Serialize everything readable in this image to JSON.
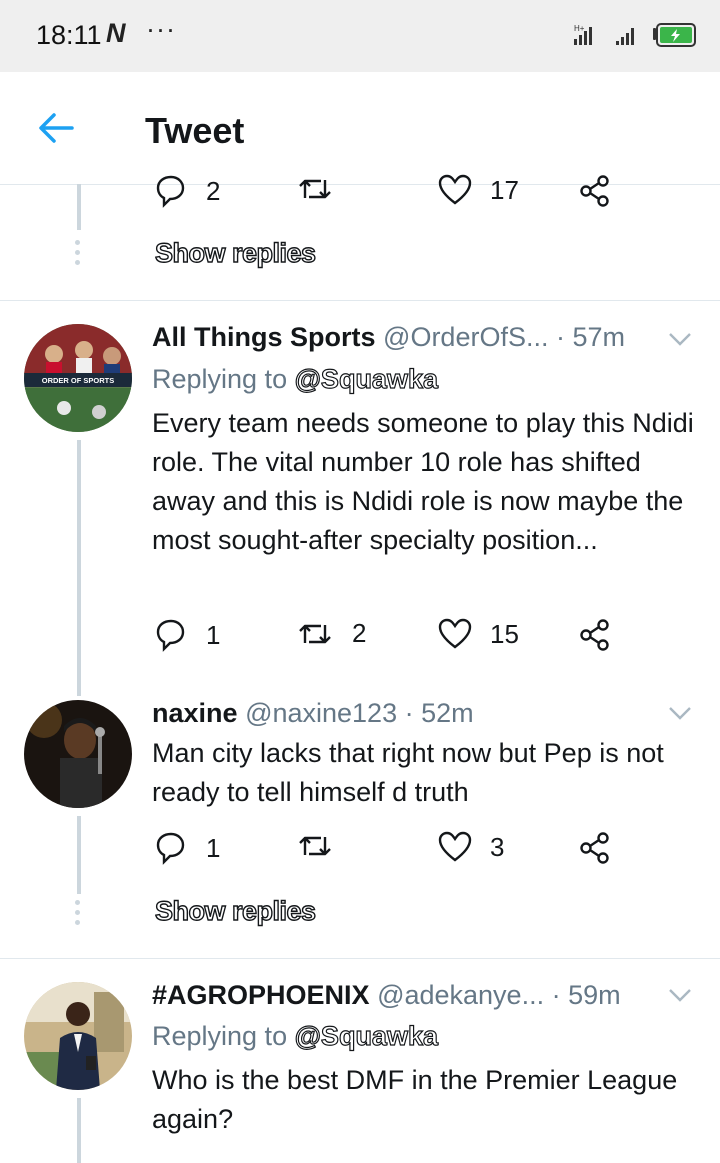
{
  "status_bar": {
    "time": "18:11",
    "carrier_glyph": "N",
    "more": "···",
    "battery_color": "#3bb54a"
  },
  "app_bar": {
    "back_icon": "arrow-left-icon",
    "title": "Tweet",
    "accent": "#1da1f2"
  },
  "top_partial": {
    "reply_count": "2",
    "retweet_count": "",
    "like_count": "17",
    "show_replies": "Show replies"
  },
  "tweets": [
    {
      "name": "All Things Sports",
      "handle": "@OrderOfS...",
      "time": "· 57m",
      "replying_prefix": "Replying to",
      "replying_to": "@Squawka",
      "text": "Every team needs someone to play this Ndidi role. The vital number 10 role has shifted away and this is Ndidi role is now maybe the most sought-after specialty position...",
      "reply_count": "1",
      "retweet_count": "2",
      "like_count": "15",
      "avatar_label": "ORDER OF SPORTS"
    },
    {
      "name": "naxine",
      "handle": "@naxine123",
      "time": "· 52m",
      "text": "Man city lacks that right now but Pep is not ready to tell himself d truth",
      "reply_count": "1",
      "retweet_count": "",
      "like_count": "3",
      "show_replies": "Show replies"
    },
    {
      "name": "#AGROPHOENIX",
      "handle": "@adekanye...",
      "time": "· 59m",
      "replying_prefix": "Replying to",
      "replying_to": "@Squawka",
      "text": "Who is the best DMF in the Premier League again?"
    }
  ]
}
